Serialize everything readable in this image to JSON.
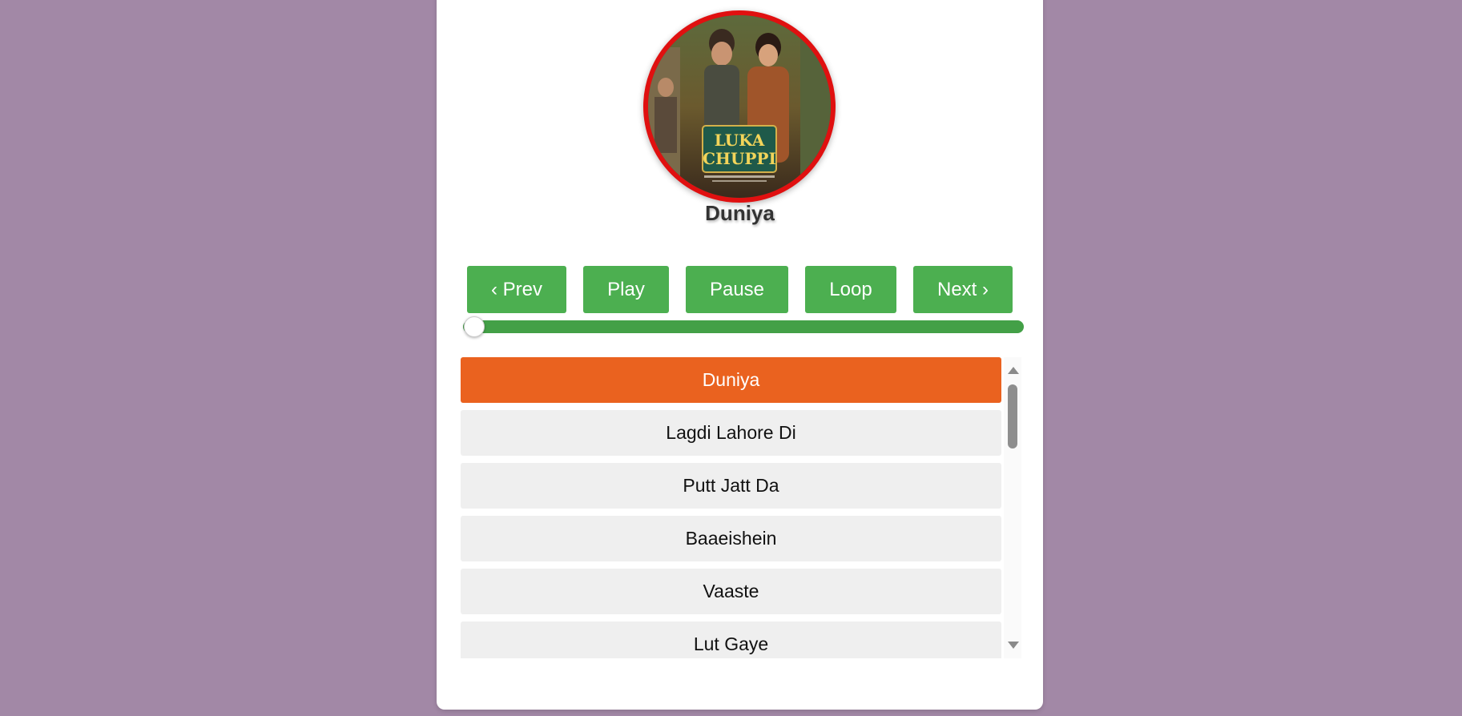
{
  "player": {
    "now_playing": "Duniya",
    "progress_fraction": 0.02,
    "cover": {
      "logo_line1": "LUKA",
      "logo_line2": "CHUPPI"
    },
    "controls": {
      "prev": "‹ Prev",
      "play": "Play",
      "pause": "Pause",
      "loop": "Loop",
      "next": "Next ›"
    },
    "playlist": [
      {
        "title": "Duniya",
        "active": true
      },
      {
        "title": "Lagdi Lahore Di",
        "active": false
      },
      {
        "title": "Putt Jatt Da",
        "active": false
      },
      {
        "title": "Baaeishein",
        "active": false
      },
      {
        "title": "Vaaste",
        "active": false
      },
      {
        "title": "Lut Gaye",
        "active": false
      }
    ]
  },
  "colors": {
    "background": "#a288a6",
    "button": "#4caf50",
    "active_item": "#ea621f",
    "cover_border": "#e01010"
  }
}
